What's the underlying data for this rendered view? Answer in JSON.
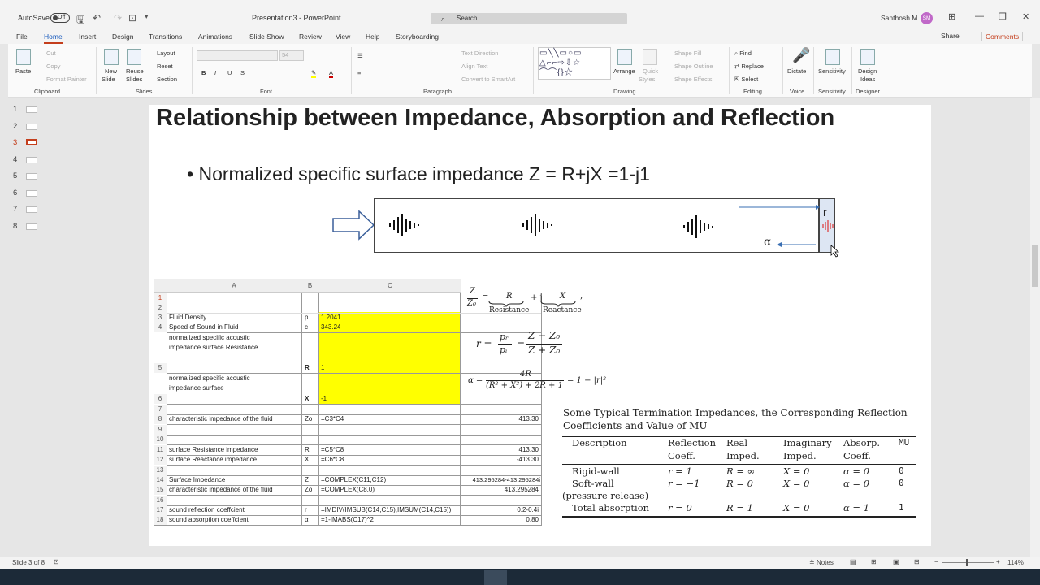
{
  "app": {
    "autosave": "AutoSave",
    "toggle": "Off",
    "doc_title": "Presentation3 - PowerPoint",
    "search_placeholder": "Search",
    "user_name": "Santhosh M",
    "user_initials": "SM"
  },
  "menu": [
    "File",
    "Home",
    "Insert",
    "Design",
    "Transitions",
    "Animations",
    "Slide Show",
    "Review",
    "View",
    "Help",
    "Storyboarding"
  ],
  "share": "Share",
  "comments": "Comments",
  "ribbon": {
    "clipboard": {
      "paste": "Paste",
      "cut": "Cut",
      "copy": "Copy",
      "format_painter": "Format Painter",
      "group": "Clipboard"
    },
    "slides": {
      "new_slide": "New",
      "new_slide2": "Slide",
      "reuse": "Reuse",
      "reuse2": "Slides",
      "layout": "Layout",
      "reset": "Reset",
      "section": "Section",
      "group": "Slides"
    },
    "font": {
      "group": "Font",
      "size": "54"
    },
    "paragraph": {
      "text_direction": "Text Direction",
      "align_text": "Align Text",
      "smartart": "Convert to SmartArt",
      "group": "Paragraph"
    },
    "drawing": {
      "arrange": "Arrange",
      "quick": "Quick",
      "styles": "Styles",
      "shape_fill": "Shape Fill",
      "shape_outline": "Shape Outline",
      "shape_effects": "Shape Effects",
      "group": "Drawing"
    },
    "editing": {
      "find": "Find",
      "replace": "Replace",
      "select": "Select",
      "group": "Editing"
    },
    "voice": {
      "dictate": "Dictate",
      "group": "Voice"
    },
    "sensitivity": {
      "label": "Sensitivity",
      "group": "Sensitivity"
    },
    "designer": {
      "label1": "Design",
      "label2": "Ideas",
      "group": "Designer"
    }
  },
  "slides_panel": [
    "1",
    "2",
    "3",
    "4",
    "5",
    "6",
    "7",
    "8"
  ],
  "slide": {
    "title": "Relationship between Impedance, Absorption and Reflection",
    "bullet": "Normalized specific surface impedance Z = R+jX =1-j1",
    "diagram": {
      "r_label": "r",
      "alpha_label": "α"
    },
    "sheet": {
      "cols": [
        "A",
        "B",
        "C"
      ],
      "rows": [
        {
          "n": "1",
          "a": "",
          "b": "",
          "c": "",
          "d": ""
        },
        {
          "n": "2",
          "a": "",
          "b": "",
          "c": "",
          "d": ""
        },
        {
          "n": "3",
          "a": "Fluid Density",
          "b": "p",
          "c": "1.2041",
          "d": ""
        },
        {
          "n": "4",
          "a": "Speed of Sound in Fluid",
          "b": "c",
          "c": "343.24",
          "d": ""
        },
        {
          "n": "5",
          "a1": "normalized specific acoustic",
          "a2": "impedance surface Resistance",
          "b": "R",
          "c": "1",
          "d": ""
        },
        {
          "n": "6",
          "a1": "normalized specific acoustic",
          "a2": "impedance surface",
          "b": "X",
          "c": "-1",
          "d": ""
        },
        {
          "n": "7",
          "a": "",
          "b": "",
          "c": "",
          "d": ""
        },
        {
          "n": "8",
          "a": "characteristic impedance of the fluid",
          "b": "Zo",
          "c": "=C3*C4",
          "d": "413.30"
        },
        {
          "n": "9",
          "a": "",
          "b": "",
          "c": "",
          "d": ""
        },
        {
          "n": "10",
          "a": "",
          "b": "",
          "c": "",
          "d": ""
        },
        {
          "n": "11",
          "a": "surface Resistance  impedance",
          "b": "R",
          "c": "=C5*C8",
          "d": "413.30"
        },
        {
          "n": "12",
          "a": "surface Reactance impedance",
          "b": "X",
          "c": "=C6*C8",
          "d": "-413.30"
        },
        {
          "n": "13",
          "a": "",
          "b": "",
          "c": "",
          "d": ""
        },
        {
          "n": "14",
          "a": "Surface Impedance",
          "b": "Z",
          "c": "=COMPLEX(C11,C12)",
          "d": "413.295284-413.295284i"
        },
        {
          "n": "15",
          "a": "characteristic impedance of the fluid",
          "b": "Zo",
          "c": "=COMPLEX(C8,0)",
          "d": "413.295284"
        },
        {
          "n": "16",
          "a": "",
          "b": "",
          "c": "",
          "d": ""
        },
        {
          "n": "17",
          "a": "sound reflection coeffcient",
          "b": "r",
          "c": "=IMDIV(IMSUB(C14,C15),IMSUM(C14,C15))",
          "d": "0.2-0.4i"
        },
        {
          "n": "18",
          "a": "sound absorption coeffcient",
          "b": "α",
          "c": "=1-IMABS(C17)^2",
          "d": "0.80"
        }
      ]
    },
    "eq1": {
      "lhs_num": "Z",
      "lhs_den": "Z₀",
      "eq": "=",
      "R": "R",
      "plus": "+ j",
      "X": "X",
      "res": "Resistance",
      "rea": "Reactance",
      "tail": ","
    },
    "eq2": {
      "lhs": "r =",
      "pr": "pᵣ",
      "pi": "pᵢ",
      "eq": "=",
      "num": "Z − Z₀",
      "den": "Z + Z₀"
    },
    "eq3": {
      "lhs": "α =",
      "num": "4R",
      "den": "(R² + X²) + 2R + 1",
      "rhs": "= 1 − |r|²"
    },
    "table": {
      "caption1": "Some Typical Termination Impedances, the Corresponding Reflection",
      "caption2": "Coefficients and Value of MU",
      "head1": [
        "Description",
        "Reflection",
        "Real",
        "Imaginary",
        "Absorp.",
        "MU"
      ],
      "head2": [
        "",
        "Coeff.",
        "Imped.",
        "Imped.",
        "Coeff.",
        ""
      ],
      "rows": [
        [
          "Rigid-wall",
          "r = 1",
          "R = ∞",
          "X = 0",
          "α = 0",
          "0"
        ],
        [
          "Soft-wall",
          "r = −1",
          "R = 0",
          "X = 0",
          "α = 0",
          "0"
        ],
        [
          "(pressure release)",
          "",
          "",
          "",
          "",
          ""
        ],
        [
          "Total absorption",
          "r = 0",
          "R = 1",
          "X = 0",
          "α = 1",
          "1"
        ]
      ]
    }
  },
  "status": {
    "slide_of": "Slide 3 of 8",
    "notes": "Notes",
    "zoom": "114%"
  }
}
